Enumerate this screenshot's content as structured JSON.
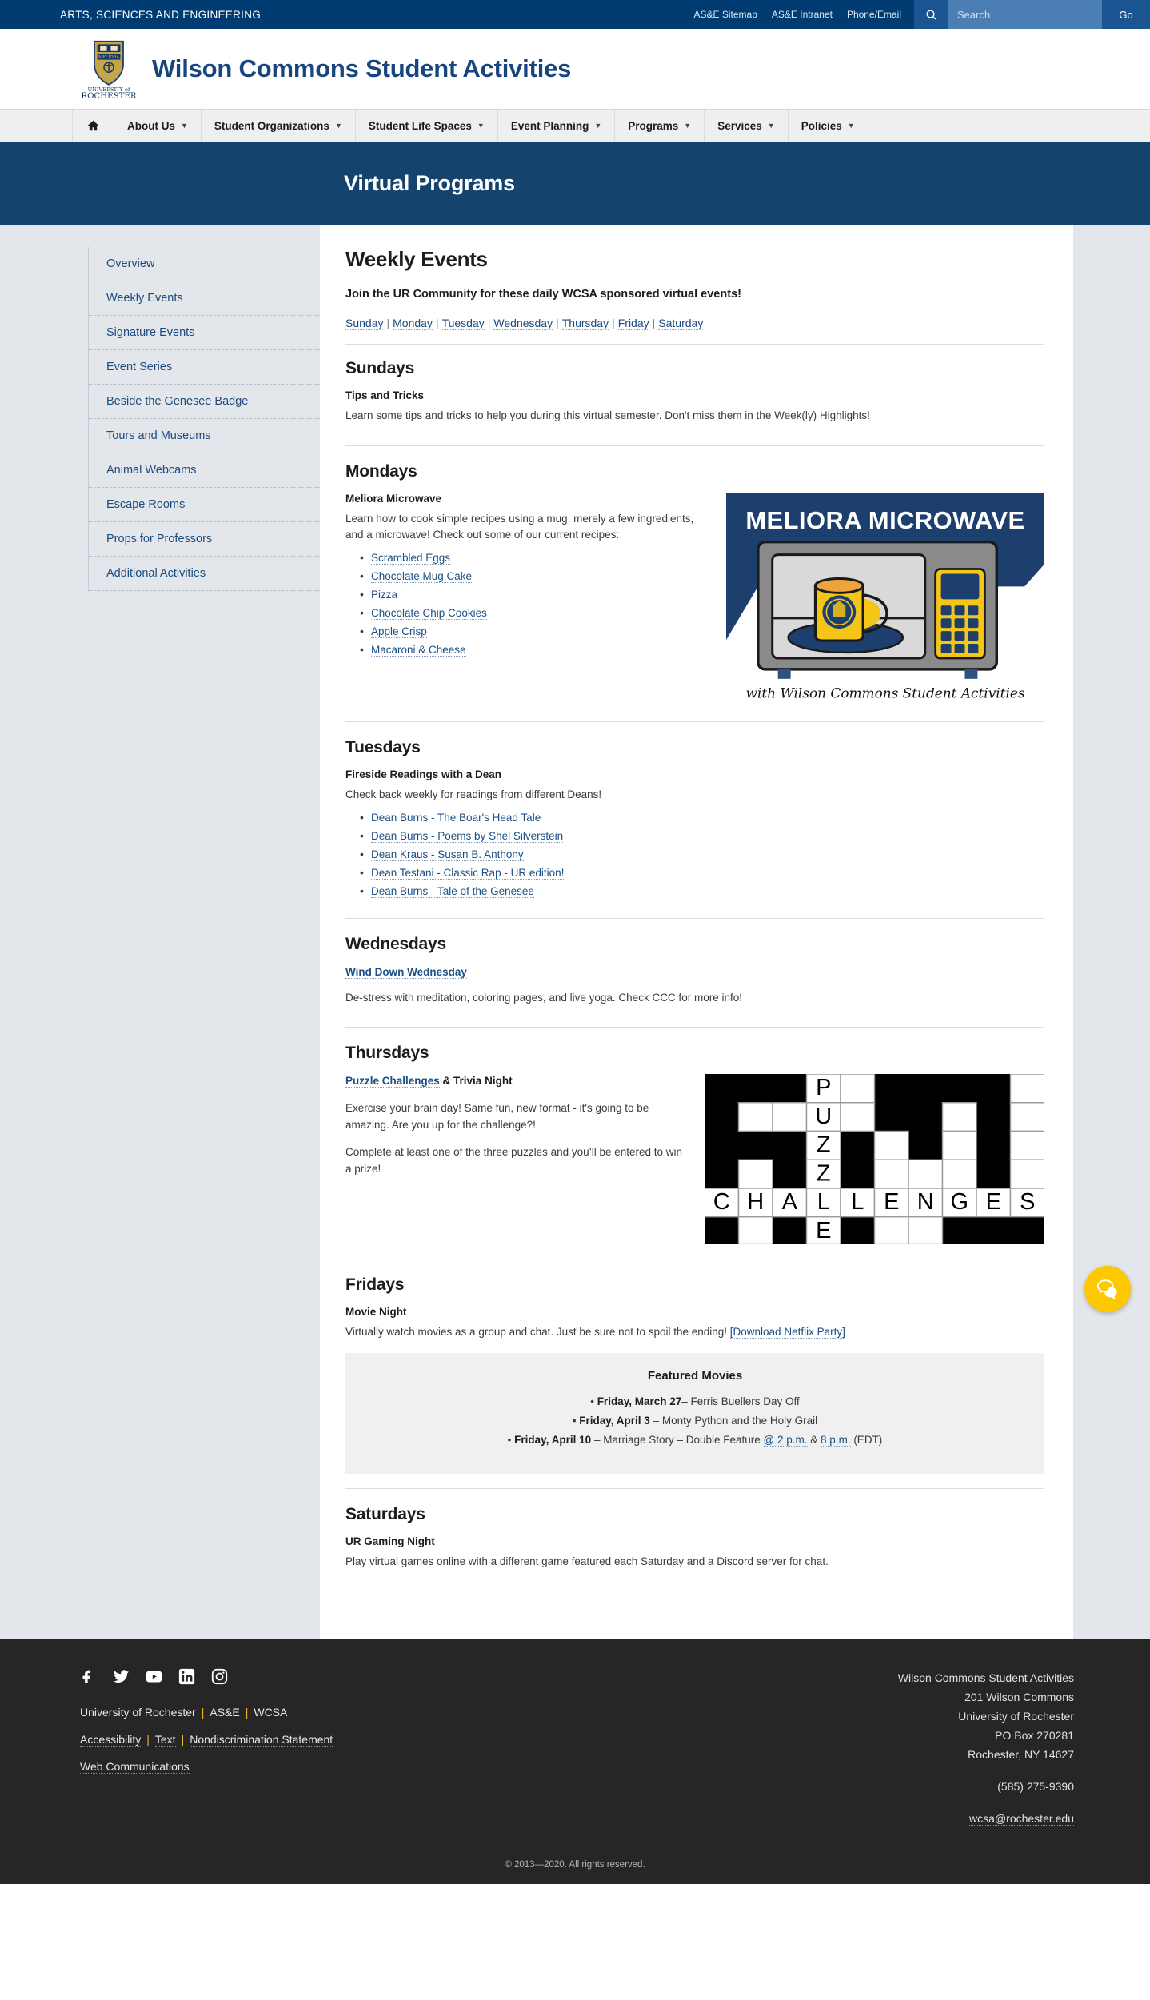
{
  "topbar": {
    "division": "ARTS, SCIENCES AND ENGINEERING",
    "links": [
      "AS&E Sitemap",
      "AS&E Intranet",
      "Phone/Email"
    ],
    "search_placeholder": "Search",
    "search_value": "",
    "go_label": "Go"
  },
  "masthead": {
    "site_title": "Wilson Commons Student Activities"
  },
  "mainnav": {
    "items": [
      {
        "label": "",
        "icon": "home-icon",
        "caret": false
      },
      {
        "label": "About Us",
        "caret": true
      },
      {
        "label": "Student Organizations",
        "caret": true
      },
      {
        "label": "Student Life Spaces",
        "caret": true
      },
      {
        "label": "Event Planning",
        "caret": true
      },
      {
        "label": "Programs",
        "caret": true
      },
      {
        "label": "Services",
        "caret": true
      },
      {
        "label": "Policies",
        "caret": true
      }
    ]
  },
  "banner": {
    "title": "Virtual Programs"
  },
  "sidebar": {
    "items": [
      "Overview",
      "Weekly Events",
      "Signature Events",
      "Event Series",
      "Beside the Genesee Badge",
      "Tours and Museums",
      "Animal Webcams",
      "Escape Rooms",
      "Props for Professors",
      "Additional Activities"
    ]
  },
  "main": {
    "heading": "Weekly Events",
    "lead": "Join the UR Community for these daily WCSA sponsored virtual events!",
    "day_links": [
      "Sunday",
      "Monday",
      "Tuesday",
      "Wednesday",
      "Thursday",
      "Friday",
      "Saturday"
    ],
    "sundays": {
      "heading": "Sundays",
      "sub": "Tips and Tricks",
      "body": "Learn some tips and tricks to help you during this virtual semester. Don't miss them in the Week(ly) Highlights!"
    },
    "mondays": {
      "heading": "Mondays",
      "sub": "Meliora Microwave",
      "body": "Learn how to cook simple recipes using a mug, merely a few ingredients, and a microwave! Check out some of our current recipes:",
      "recipes": [
        "Scrambled Eggs",
        "Chocolate Mug Cake",
        "Pizza",
        "Chocolate Chip Cookies",
        "Apple Crisp",
        "Macaroni & Cheese"
      ],
      "graphic": {
        "title": "MELIORA MICROWAVE",
        "caption": "with Wilson Commons Student Activities",
        "colors": {
          "navy": "#1c3f6e",
          "gray": "#8a8a8a",
          "yellow": "#f5c518",
          "light": "#d9d9d9"
        }
      }
    },
    "tuesdays": {
      "heading": "Tuesdays",
      "sub": "Fireside Readings with a Dean",
      "body": "Check back weekly for readings from different Deans!",
      "readings": [
        "Dean Burns - The Boar's Head Tale",
        "Dean Burns - Poems by Shel Silverstein",
        "Dean Kraus - Susan B. Anthony",
        "Dean Testani - Classic Rap - UR edition!",
        "Dean Burns - Tale of the Genesee"
      ]
    },
    "wednesdays": {
      "heading": "Wednesdays",
      "sub_link": "Wind Down Wednesday",
      "body": "De-stress with meditation, coloring pages, and live yoga. Check CCC for more info!"
    },
    "thursdays": {
      "heading": "Thursdays",
      "sub_link": "Puzzle Challenges",
      "sub_rest": " & Trivia Night",
      "body1": "Exercise your brain day! Same fun, new format - it's going to be amazing. Are you up for the challenge?!",
      "body2": "Complete at least one of the three puzzles and you’ll be entered to win a prize!",
      "graphic": {
        "word_down": "PUZZLE",
        "word_across": "CHALLENGES"
      }
    },
    "fridays": {
      "heading": "Fridays",
      "sub": "Movie Night",
      "body": "Virtually watch movies as a group and chat. Just be sure not to spoil the ending! ",
      "netflix_link": "[Download Netflix Party]",
      "movies_title": "Featured Movies",
      "movies": [
        {
          "date": "Friday, March 27",
          "rest": "– Ferris Buellers Day Off"
        },
        {
          "date": "Friday, April 3",
          "rest": " – Monty Python and the Holy Grail"
        },
        {
          "date": "Friday, April 10",
          "rest": " – Marriage Story – Double Feature ",
          "time1": "@ 2 p.m.",
          "between": " & ",
          "time2": "8 p.m.",
          "tz": " (EDT)"
        }
      ]
    },
    "saturdays": {
      "heading": "Saturdays",
      "sub": "UR Gaming Night",
      "body": "Play virtual games online with a different game featured each Saturday and a Discord server for chat."
    }
  },
  "chat": {
    "label": "chat-bubble-icon",
    "color": "#fcc800"
  },
  "footer": {
    "social": [
      "facebook-icon",
      "twitter-icon",
      "youtube-icon",
      "linkedin-icon",
      "instagram-icon"
    ],
    "row1": [
      "University of Rochester",
      "AS&E",
      "WCSA"
    ],
    "row2": [
      "Accessibility",
      "Text",
      "Nondiscrimination Statement"
    ],
    "row3": [
      "Web Communications"
    ],
    "address": [
      "Wilson Commons Student Activities",
      "201 Wilson Commons",
      "University of Rochester",
      "PO Box 270281",
      "Rochester, NY 14627"
    ],
    "phone": "(585) 275-9390",
    "email": "wcsa@rochester.edu",
    "copyright": "© 2013—2020. All rights reserved."
  }
}
